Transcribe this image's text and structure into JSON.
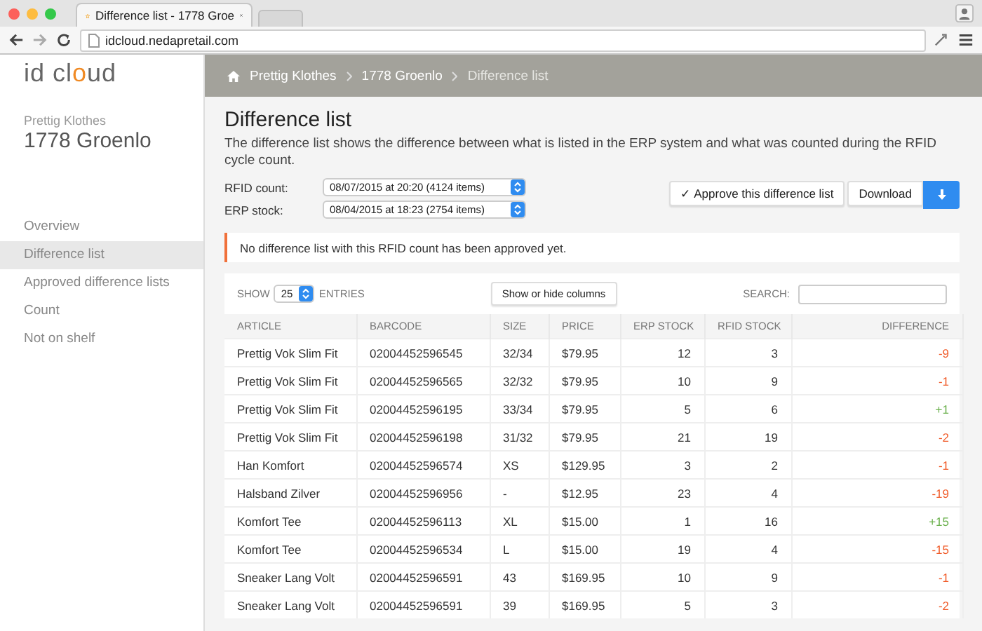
{
  "browser": {
    "tab_title": "Difference list - 1778 Groe",
    "url": "idcloud.nedapretail.com"
  },
  "sidebar": {
    "logo": {
      "prefix": "id cl",
      "accent": "o",
      "suffix": "ud"
    },
    "company": "Prettig Klothes",
    "store": "1778 Groenlo",
    "items": [
      {
        "label": "Overview",
        "selected": false
      },
      {
        "label": "Difference list",
        "selected": true
      },
      {
        "label": "Approved difference lists",
        "selected": false
      },
      {
        "label": "Count",
        "selected": false
      },
      {
        "label": "Not on shelf",
        "selected": false
      }
    ]
  },
  "breadcrumb": [
    "Prettig Klothes",
    "1778 Groenlo",
    "Difference list"
  ],
  "page": {
    "title": "Difference list",
    "description": "The difference list shows the difference between what is listed in the ERP system and what was counted during the RFID cycle count.",
    "filters": [
      {
        "label": "RFID count:",
        "value": "08/07/2015 at 20:20 (4124 items)"
      },
      {
        "label": "ERP stock:",
        "value": "08/04/2015 at 18:23 (2754 items)"
      }
    ],
    "approve_button": "✓ Approve this difference list",
    "download_button": "Download",
    "alert": "No difference list with this RFID count has been approved yet."
  },
  "table": {
    "show_label": "SHOW",
    "entries_value": "25",
    "entries_label": "ENTRIES",
    "columns_button": "Show or hide columns",
    "search_label": "SEARCH:",
    "columns": [
      "ARTICLE",
      "BARCODE",
      "SIZE",
      "PRICE",
      "ERP STOCK",
      "RFID STOCK",
      "DIFFERENCE"
    ],
    "rows": [
      {
        "cells": [
          "Prettig Vok Slim Fit",
          "02004452596545",
          "32/34",
          "$79.95",
          "12",
          "3",
          "-9"
        ],
        "color": "#f05a28"
      },
      {
        "cells": [
          "Prettig Vok Slim Fit",
          "02004452596565",
          "32/32",
          "$79.95",
          "10",
          "9",
          "-1"
        ],
        "color": "#f05a28"
      },
      {
        "cells": [
          "Prettig Vok Slim Fit",
          "02004452596195",
          "33/34",
          "$79.95",
          "5",
          "6",
          "+1"
        ],
        "color": "#6ab04c"
      },
      {
        "cells": [
          "Prettig Vok Slim Fit",
          "02004452596198",
          "31/32",
          "$79.95",
          "21",
          "19",
          "-2"
        ],
        "color": "#f05a28"
      },
      {
        "cells": [
          "Han Komfort",
          "02004452596574",
          "XS",
          "$129.95",
          "3",
          "2",
          "-1"
        ],
        "color": "#f05a28"
      },
      {
        "cells": [
          "Halsband Zilver",
          "02004452596956",
          "-",
          "$12.95",
          "23",
          "4",
          "-19"
        ],
        "color": "#f05a28"
      },
      {
        "cells": [
          "Komfort Tee",
          "02004452596113",
          "XL",
          "$15.00",
          "1",
          "16",
          "+15"
        ],
        "color": "#6ab04c"
      },
      {
        "cells": [
          "Komfort Tee",
          "02004452596534",
          "L",
          "$15.00",
          "19",
          "4",
          "-15"
        ],
        "color": "#f05a28"
      },
      {
        "cells": [
          "Sneaker Lang Volt",
          "02004452596591",
          "43",
          "$169.95",
          "10",
          "9",
          "-1"
        ],
        "color": "#f05a28"
      },
      {
        "cells": [
          "Sneaker Lang Volt",
          "02004452596591",
          "39",
          "$169.95",
          "5",
          "3",
          "-2"
        ],
        "color": "#f05a28"
      }
    ]
  }
}
